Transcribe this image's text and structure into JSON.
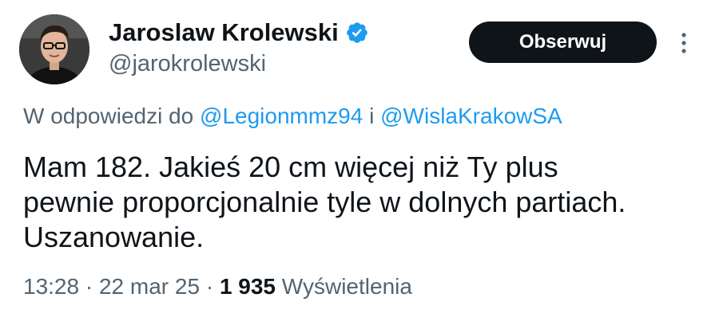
{
  "author": {
    "display_name": "Jaroslaw Krolewski",
    "handle": "@jarokrolewski",
    "verified": true,
    "verified_color": "#1d9bf0"
  },
  "actions": {
    "follow_label": "Obserwuj",
    "more_icon": "more-vertical-icon"
  },
  "reply": {
    "prefix": "W odpowiedzi do",
    "mention_1": "@Legionmmz94",
    "conjunction": "i",
    "mention_2": "@WislaKrakowSA"
  },
  "tweet": {
    "lines": [
      "Mam 182. Jakieś 20 cm więcej niż Ty plus",
      "pewnie proporcjonalnie tyle w dolnych partiach.",
      "Uszanowanie."
    ]
  },
  "meta": {
    "time": "13:28",
    "separator": "·",
    "date": "22 mar 25",
    "views_count": "1 935",
    "views_label": "Wyświetlenia"
  },
  "colors": {
    "text": "#0f1419",
    "secondary": "#536471",
    "link": "#1d9bf0",
    "button_bg": "#0f1419",
    "button_text": "#ffffff"
  }
}
